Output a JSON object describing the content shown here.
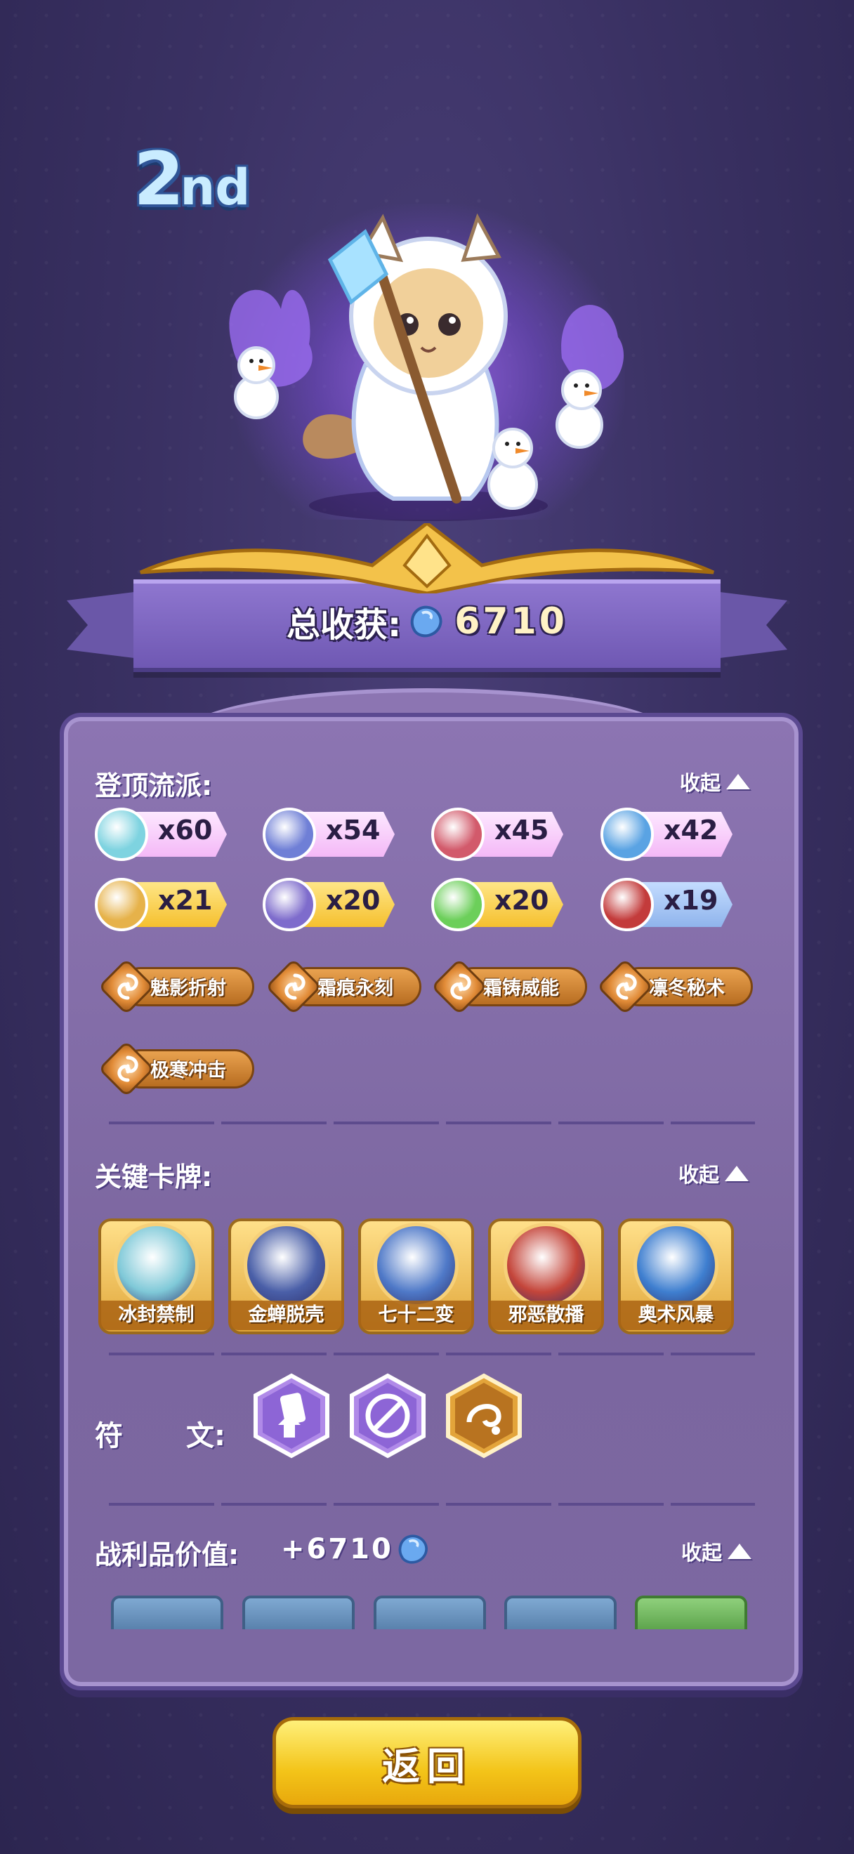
{
  "rank": {
    "number": "2",
    "suffix": "nd"
  },
  "summary": {
    "total_label": "总收获:",
    "total_value": "6710"
  },
  "sections": {
    "genre": {
      "title": "登顶流派:",
      "collapse": "收起",
      "counters": [
        {
          "icon": "snowflake-icon",
          "value": "x60",
          "style": "pink",
          "color": "#7ed3e0"
        },
        {
          "icon": "dove-icon",
          "value": "x54",
          "style": "pink",
          "color": "#6f7fd6"
        },
        {
          "icon": "claw-icon",
          "value": "x45",
          "style": "pink",
          "color": "#d25a6b"
        },
        {
          "icon": "droplet-icon",
          "value": "x42",
          "style": "pink",
          "color": "#5aa3e3"
        },
        {
          "icon": "heart-icon",
          "value": "x21",
          "style": "gold",
          "color": "#e6b24a"
        },
        {
          "icon": "sword-icon",
          "value": "x20",
          "style": "gold",
          "color": "#7e6ccc"
        },
        {
          "icon": "potion-icon",
          "value": "x20",
          "style": "gold",
          "color": "#6ccf5a"
        },
        {
          "icon": "flame-icon",
          "value": "x19",
          "style": "blue",
          "color": "#c33b3b"
        }
      ],
      "tags": [
        "魅影折射",
        "霜痕永刻",
        "霜铸威能",
        "凛冬秘术",
        "极寒冲击"
      ]
    },
    "cards": {
      "title": "关键卡牌:",
      "collapse": "收起",
      "items": [
        {
          "name": "冰封禁制",
          "color": "#7fc9d8"
        },
        {
          "name": "金蝉脱壳",
          "color": "#4a5fa8"
        },
        {
          "name": "七十二变",
          "color": "#4f79c8"
        },
        {
          "name": "邪恶散播",
          "color": "#c4453a"
        },
        {
          "name": "奥术风暴",
          "color": "#3f7fd0"
        }
      ]
    },
    "runes": {
      "label_a": "符",
      "label_b": "文:"
    },
    "loot": {
      "title": "战利品价值:",
      "value": "+6710",
      "collapse": "收起"
    }
  },
  "buttons": {
    "back": "返回"
  }
}
